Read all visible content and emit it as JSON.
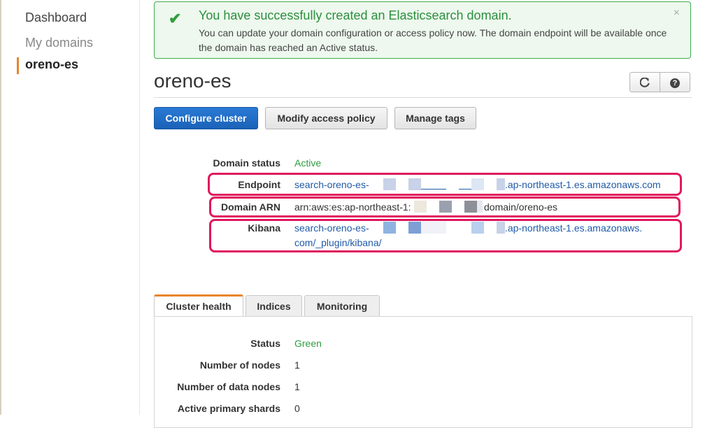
{
  "sidebar": {
    "dashboard": "Dashboard",
    "my_domains": "My domains",
    "active_domain": "oreno-es"
  },
  "flash": {
    "title": "You have successfully created an Elasticsearch domain.",
    "text": "You can update your domain configuration or access policy now. The domain endpoint will be available once the domain has reached an Active status.",
    "close": "×",
    "check": "✔"
  },
  "page": {
    "title": "oreno-es",
    "refresh_icon": "refresh-icon",
    "help_icon": "help-icon"
  },
  "actions": {
    "configure": "Configure cluster",
    "modify_policy": "Modify access policy",
    "manage_tags": "Manage tags"
  },
  "details": {
    "domain_status_label": "Domain status",
    "domain_status_value": "Active",
    "endpoint_label": "Endpoint",
    "endpoint_prefix": "search-oreno-es-",
    "endpoint_suffix": ".ap-northeast-1.es.amazonaws.com",
    "arn_label": "Domain ARN",
    "arn_prefix": "arn:aws:es:ap-northeast-1:",
    "arn_suffix": "domain/oreno-es",
    "kibana_label": "Kibana",
    "kibana_prefix": "search-oreno-es-",
    "kibana_suffix": ".ap-northeast-1.es.amazonaws.",
    "kibana_line2": "com/_plugin/kibana/"
  },
  "tabs": [
    {
      "label": "Cluster health",
      "active": true
    },
    {
      "label": "Indices",
      "active": false
    },
    {
      "label": "Monitoring",
      "active": false
    }
  ],
  "health": {
    "rows": [
      {
        "label": "Status",
        "value": "Green"
      },
      {
        "label": "Number of nodes",
        "value": "1"
      },
      {
        "label": "Number of data nodes",
        "value": "1"
      },
      {
        "label": "Active primary shards",
        "value": "0"
      }
    ]
  },
  "colors": {
    "accent": "#e7852a",
    "primary": "#1a62b8",
    "success": "#2e9e3e",
    "highlight": "#e0185e"
  }
}
